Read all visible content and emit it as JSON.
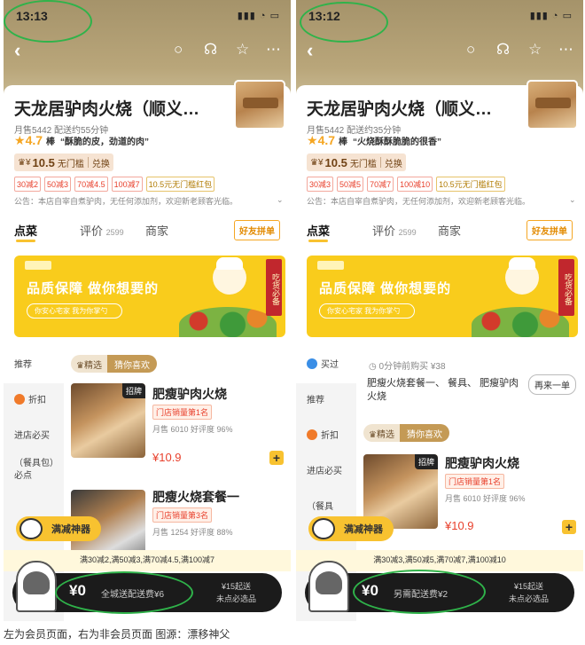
{
  "colors": {
    "accent": "#f8c230",
    "price": "#e8402c",
    "highlight": "#2fb34a"
  },
  "left": {
    "time": "13:13",
    "shop_name": "天龙居驴肉火烧（顺义…",
    "meta": "月售5442  配送约55分钟",
    "rating": "4.7",
    "rating_label": "棒",
    "comment": "“酥脆的皮，劲道的肉”",
    "vip": {
      "prefix": "¥",
      "amount": "10.5",
      "desc": "无门槛",
      "action": "兑换"
    },
    "tags": [
      "30减2",
      "50减3",
      "70减4.5",
      "100减7",
      "10.5元无门槛红包"
    ],
    "notice": "公告：本店自宰自煮驴肉，无任何添加剂，欢迎新老顾客光临。",
    "tabs": [
      {
        "label": "点菜"
      },
      {
        "label": "评价",
        "count": "2599"
      },
      {
        "label": "商家"
      }
    ],
    "group_button": "好友拼单",
    "banner": {
      "title": "品质保障 做你想要的",
      "subtitle": "你安心宅家 我为你掌勺",
      "scroll": "吃货必备"
    },
    "sidebar": [
      "推荐",
      "折扣",
      "进店必买",
      "（餐具包）必点",
      ""
    ],
    "filter": {
      "a": "精选",
      "b": "猜你喜欢"
    },
    "item1": {
      "badge": "招牌",
      "name": "肥瘦驴肉火烧",
      "rank": "门店销量第1名",
      "sales": "月售 6010  好评度 96%",
      "price": "¥10.9"
    },
    "item2": {
      "name": "肥瘦火烧套餐一",
      "rank": "门店销量第3名",
      "sales": "月售 1254  好评度 88%"
    },
    "promo": "满减神器",
    "strip": "满30减2,满50减3,满70减4.5,满100减7",
    "cart": {
      "amount": "¥0",
      "fee": "全城送配送费¥6",
      "min1": "¥15起送",
      "min2": "未点必选品"
    }
  },
  "right": {
    "time": "13:12",
    "shop_name": "天龙居驴肉火烧（顺义…",
    "meta": "月售5442  配送约35分钟",
    "rating": "4.7",
    "rating_label": "棒",
    "comment": "“火烧酥酥脆脆的很香”",
    "vip": {
      "prefix": "¥",
      "amount": "10.5",
      "desc": "无门槛",
      "action": "兑换"
    },
    "tags": [
      "30减3",
      "50减5",
      "70减7",
      "100减10",
      "10.5元无门槛红包"
    ],
    "notice": "公告：本店自宰自煮驴肉，无任何添加剂，欢迎新老顾客光临。",
    "tabs": [
      {
        "label": "点菜"
      },
      {
        "label": "评价",
        "count": "2599"
      },
      {
        "label": "商家"
      }
    ],
    "group_button": "好友拼单",
    "banner": {
      "title": "品质保障 做你想要的",
      "subtitle": "你安心宅家 我为你掌勺",
      "scroll": "吃货必备"
    },
    "sidebar": [
      "买过",
      "推荐",
      "折扣",
      "进店必买",
      "（餐具"
    ],
    "recent": "0分钟前购买  ¥38",
    "combo": "肥瘦火烧套餐一、 餐具、 肥瘦驴肉火烧",
    "reorder": "再来一单",
    "filter": {
      "a": "精选",
      "b": "猜你喜欢"
    },
    "item1": {
      "badge": "招牌",
      "name": "肥瘦驴肉火烧",
      "rank": "门店销量第1名",
      "sales": "月售 6010  好评度 96%",
      "price": "¥10.9"
    },
    "promo": "满减神器",
    "strip": "满30减3,满50减5,满70减7,满100减10",
    "cart": {
      "amount": "¥0",
      "fee": "另需配送费¥2",
      "min1": "¥15起送",
      "min2": "未点必选品"
    }
  },
  "caption": "左为会员页面，右为非会员页面 图源：漂移神父"
}
